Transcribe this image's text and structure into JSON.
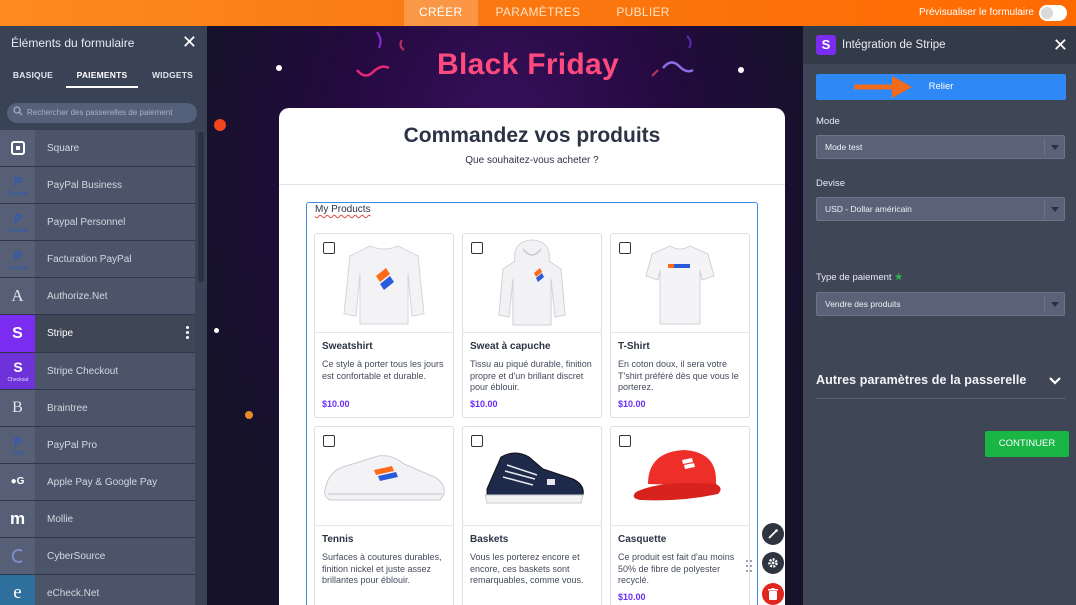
{
  "topbar": {
    "tabs": [
      "CRÉER",
      "PARAMÈTRES",
      "PUBLIER"
    ],
    "active_tab": 0,
    "preview_label": "Prévisualiser le formulaire"
  },
  "left": {
    "title": "Éléments du formulaire",
    "subtabs": [
      "BASIQUE",
      "PAIEMENTS",
      "WIDGETS"
    ],
    "active_subtab": 1,
    "search_placeholder": "Rechercher des passerelles de paiement",
    "items": [
      {
        "label": "Square",
        "icon": "square-icon"
      },
      {
        "label": "PayPal Business",
        "icon": "paypal-business-icon"
      },
      {
        "label": "Paypal Personnel",
        "icon": "paypal-personal-icon"
      },
      {
        "label": "Facturation PayPal",
        "icon": "paypal-invoicing-icon"
      },
      {
        "label": "Authorize.Net",
        "icon": "authorize-net-icon"
      },
      {
        "label": "Stripe",
        "icon": "stripe-icon"
      },
      {
        "label": "Stripe Checkout",
        "icon": "stripe-checkout-icon"
      },
      {
        "label": "Braintree",
        "icon": "braintree-icon"
      },
      {
        "label": "PayPal Pro",
        "icon": "paypal-pro-icon"
      },
      {
        "label": "Apple Pay & Google Pay",
        "icon": "apple-google-pay-icon"
      },
      {
        "label": "Mollie",
        "icon": "mollie-icon"
      },
      {
        "label": "CyberSource",
        "icon": "cybersource-icon"
      },
      {
        "label": "eCheck.Net",
        "icon": "echeck-icon"
      }
    ],
    "badge_sub": {
      "business": "Business",
      "personal": "Personal",
      "invoicing": "Invoicing",
      "checkout": "Checkout",
      "pro": "PRO"
    }
  },
  "canvas": {
    "banner_title": "Black Friday",
    "form_title": "Commandez vos produits",
    "form_subtitle": "Que souhaitez-vous acheter ?",
    "field_label": "My Products",
    "products": [
      {
        "name": "Sweatshirt",
        "desc": "Ce style à porter tous les jours est confortable et durable.",
        "price": "$10.00"
      },
      {
        "name": "Sweat à capuche",
        "desc": "Tissu au piqué durable, finition propre et d'un brillant discret pour éblouir.",
        "price": "$10.00"
      },
      {
        "name": "T-Shirt",
        "desc": "En coton doux, il sera votre T'shirt préféré dès que vous le porterez.",
        "price": "$10.00"
      },
      {
        "name": "Tennis",
        "desc": "Surfaces à coutures durables, finition nickel et juste assez brillantes pour éblouir.",
        "price": ""
      },
      {
        "name": "Baskets",
        "desc": "Vous les porterez encore et encore, ces baskets sont remarquables, comme vous.",
        "price": ""
      },
      {
        "name": "Casquette",
        "desc": "Ce produit est fait d'au moins 50% de fibre de polyester recyclé.",
        "price": "$10.00"
      }
    ]
  },
  "right": {
    "title": "Intégration de Stripe",
    "connect_label": "Relier",
    "mode_label": "Mode",
    "mode_value": "Mode test",
    "currency_label": "Devise",
    "currency_value": "USD - Dollar américain",
    "payment_type_label": "Type de paiement",
    "payment_type_value": "Vendre des produits",
    "other_settings_label": "Autres paramètres de la passerelle",
    "continue_label": "CONTINUER"
  },
  "colors": {
    "accent_orange": "#ff7a14",
    "stripe_purple": "#7a2cf0",
    "connect_blue": "#2e88f5",
    "continue_green": "#19b545",
    "price_purple": "#6b2cf5",
    "banner_pink": "#ff4a7d"
  }
}
